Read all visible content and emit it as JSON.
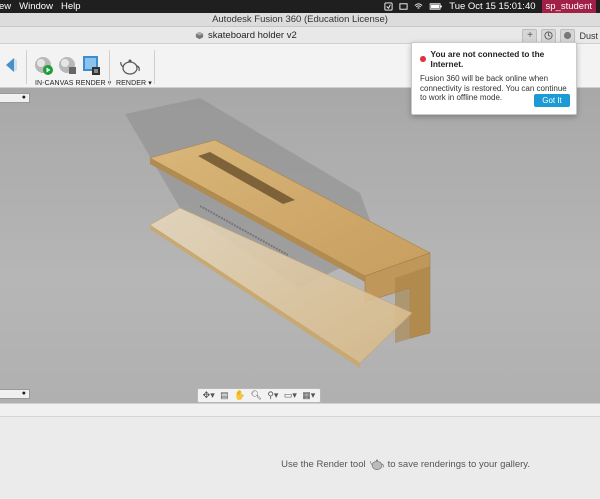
{
  "menubar": {
    "items": [
      "ew",
      "Window",
      "Help"
    ],
    "clock": "Tue Oct 15  15:01:40",
    "user": "sp_student"
  },
  "window": {
    "title": "Autodesk Fusion 360 (Education License)"
  },
  "document_tab": {
    "label": "skateboard holder v2",
    "account": "Dust"
  },
  "toolbar": {
    "in_canvas_render_label": "IN-CANVAS RENDER",
    "render_label": "RENDER"
  },
  "offline_popup": {
    "title": "You are not connected to the Internet.",
    "message": "Fusion 360 will be back online when connectivity is restored. You can continue to work in offline mode.",
    "button_label": "Got It",
    "status_color": "#e0323c",
    "button_color": "#1b9ad6"
  },
  "bottom_panel": {
    "hint_before": "Use the Render tool",
    "hint_after": "to save renderings to your gallery."
  },
  "icons": [
    "apple-icon",
    "wifi-icon",
    "battery-icon",
    "plus-icon",
    "job-status-icon",
    "orbit-icon",
    "pan-icon",
    "zoom-icon",
    "display-icon",
    "teapot-icon"
  ]
}
